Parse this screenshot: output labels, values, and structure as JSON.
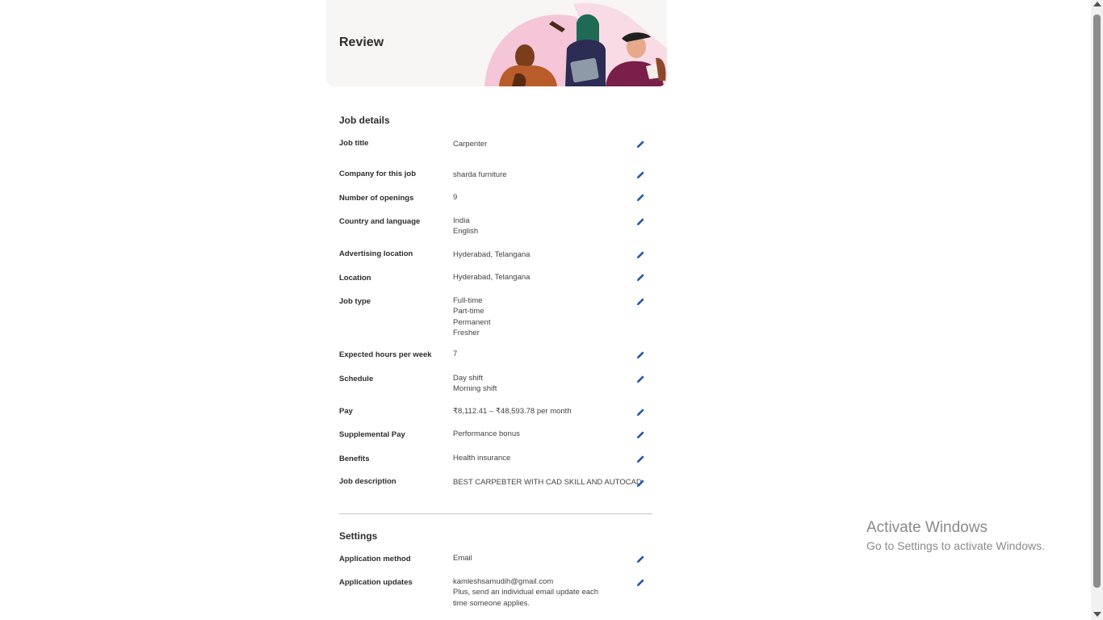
{
  "header": {
    "title": "Review"
  },
  "job_details": {
    "title": "Job details",
    "rows": [
      {
        "label": "Job title",
        "values": [
          "Carpenter"
        ]
      },
      {
        "label": "Company for this job",
        "values": [
          "sharda furniture"
        ]
      },
      {
        "label": "Number of openings",
        "values": [
          "9"
        ]
      },
      {
        "label": "Country and language",
        "values": [
          "India",
          "English"
        ]
      },
      {
        "label": "Advertising location",
        "values": [
          "Hyderabad, Telangana"
        ]
      },
      {
        "label": "Location",
        "values": [
          "Hyderabad, Telangana"
        ]
      },
      {
        "label": "Job type",
        "values": [
          "Full-time",
          "Part-time",
          "Permanent",
          "Fresher"
        ]
      },
      {
        "label": "Expected hours per week",
        "values": [
          "7"
        ]
      },
      {
        "label": "Schedule",
        "values": [
          "Day shift",
          "Morning shift"
        ]
      },
      {
        "label": "Pay",
        "values": [
          "₹8,112.41 – ₹48,593.78 per month"
        ]
      },
      {
        "label": "Supplemental Pay",
        "values": [
          "Performance bonus"
        ]
      },
      {
        "label": "Benefits",
        "values": [
          "Health insurance"
        ]
      },
      {
        "label": "Job description",
        "values": [
          "BEST CARPEBTER WITH CAD SKILL AND AUTOCAD"
        ]
      }
    ]
  },
  "settings": {
    "title": "Settings",
    "rows": [
      {
        "label": "Application method",
        "values": [
          "Email"
        ]
      },
      {
        "label": "Application updates",
        "values": [
          "kamleshsamudih@gmail.com",
          "Plus, send an individual email update each time someone applies."
        ]
      }
    ]
  },
  "watermark": {
    "title": "Activate Windows",
    "subtitle": "Go to Settings to activate Windows."
  },
  "icons": {
    "edit": "pencil-icon"
  },
  "colors": {
    "accent": "#2557a7",
    "hero_bg": "#f7f6f4",
    "divider": "#c8c8c8"
  }
}
